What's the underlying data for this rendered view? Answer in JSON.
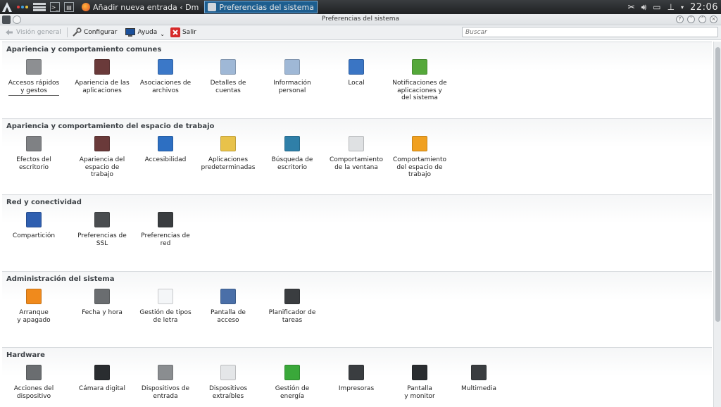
{
  "taskbar": {
    "tasks": [
      {
        "label": "Añadir nueva entrada ‹ Dm",
        "active": false
      },
      {
        "label": "Preferencias del sistema",
        "active": true
      }
    ],
    "clock": "22:06"
  },
  "window": {
    "title": "Preferencias del sistema"
  },
  "toolbar": {
    "overview": "Visión general",
    "configure": "Configurar",
    "help": "Ayuda",
    "quit": "Salir",
    "search_placeholder": "Buscar"
  },
  "sections": [
    {
      "title": "Apariencia y comportamiento comunes",
      "items": [
        {
          "label": "Accesos rápidos\ny gestos",
          "icon": "keyboard-shortcuts-icon",
          "color": "#8d8f92"
        },
        {
          "label": "Apariencia de las\naplicaciones",
          "icon": "app-appearance-icon",
          "color": "#6a3a3a"
        },
        {
          "label": "Asociaciones de\narchivos",
          "icon": "file-associations-icon",
          "color": "#3b78c8"
        },
        {
          "label": "Detalles de\ncuentas",
          "icon": "account-details-icon",
          "color": "#9fb8d6"
        },
        {
          "label": "Información\npersonal",
          "icon": "personal-info-icon",
          "color": "#9fb8d6"
        },
        {
          "label": "Local",
          "icon": "globe-icon",
          "color": "#3a75c4"
        },
        {
          "label": "Notificaciones de\naplicaciones y\ndel sistema",
          "icon": "notifications-icon",
          "color": "#55a83a"
        }
      ]
    },
    {
      "title": "Apariencia y comportamiento del espacio de trabajo",
      "items": [
        {
          "label": "Efectos del\nescritorio",
          "icon": "desktop-effects-icon",
          "color": "#7f8184"
        },
        {
          "label": "Apariencia del\nespacio de\ntrabajo",
          "icon": "workspace-appearance-icon",
          "color": "#6a3a3a"
        },
        {
          "label": "Accesibilidad",
          "icon": "accessibility-icon",
          "color": "#2d6fc2"
        },
        {
          "label": "Aplicaciones\npredeterminadas",
          "icon": "default-apps-icon",
          "color": "#e8c24a"
        },
        {
          "label": "Búsqueda de\nescritorio",
          "icon": "desktop-search-icon",
          "color": "#2f7fa8"
        },
        {
          "label": "Comportamiento\nde la ventana",
          "icon": "window-behavior-icon",
          "color": "#dfe1e3"
        },
        {
          "label": "Comportamiento\ndel espacio de\ntrabajo",
          "icon": "workspace-behavior-icon",
          "color": "#f0a020"
        }
      ]
    },
    {
      "title": "Red y conectividad",
      "items": [
        {
          "label": "Compartición",
          "icon": "sharing-icon",
          "color": "#2f5fb0"
        },
        {
          "label": "Preferencias de\nSSL",
          "icon": "ssl-icon",
          "color": "#4a4d50"
        },
        {
          "label": "Preferencias de\nred",
          "icon": "network-icon",
          "color": "#3a3d40"
        }
      ]
    },
    {
      "title": "Administración del sistema",
      "items": [
        {
          "label": "Arranque\ny apagado",
          "icon": "startup-shutdown-icon",
          "color": "#f08a1c"
        },
        {
          "label": "Fecha y hora",
          "icon": "date-time-icon",
          "color": "#6a6d70"
        },
        {
          "label": "Gestión de tipos\nde letra",
          "icon": "font-management-icon",
          "color": "#f4f6f8"
        },
        {
          "label": "Pantalla de\nacceso",
          "icon": "login-screen-icon",
          "color": "#4a6fa8"
        },
        {
          "label": "Planificador de\ntareas",
          "icon": "task-scheduler-icon",
          "color": "#3a3d40"
        }
      ]
    },
    {
      "title": "Hardware",
      "items": [
        {
          "label": "Acciones del\ndispositivo",
          "icon": "device-actions-icon",
          "color": "#6a6d70"
        },
        {
          "label": "Cámara digital",
          "icon": "camera-icon",
          "color": "#2a2d30"
        },
        {
          "label": "Dispositivos de\nentrada",
          "icon": "input-devices-icon",
          "color": "#8a8d90"
        },
        {
          "label": "Dispositivos\nextraíbles",
          "icon": "removable-devices-icon",
          "color": "#e4e6e8"
        },
        {
          "label": "Gestión de\nenergía",
          "icon": "power-management-icon",
          "color": "#3aa83a"
        },
        {
          "label": "Impresoras",
          "icon": "printer-icon",
          "color": "#3a3d40"
        },
        {
          "label": "Pantalla\ny monitor",
          "icon": "display-monitor-icon",
          "color": "#2a2d30"
        },
        {
          "label": "Multimedia",
          "icon": "multimedia-icon",
          "color": "#3a3d40"
        }
      ]
    }
  ]
}
